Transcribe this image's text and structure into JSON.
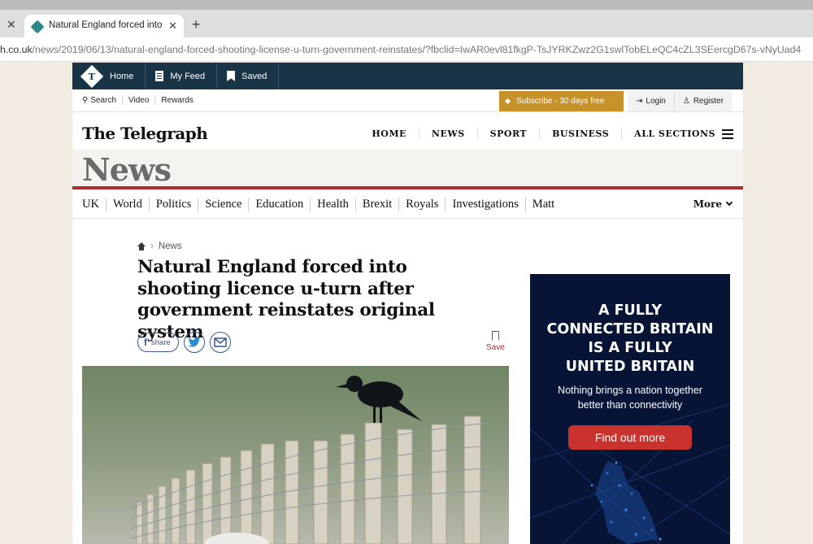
{
  "browser": {
    "tab_title": "Natural England forced into sho",
    "url_prefix": "h.co.uk",
    "url_path": "/news/2019/06/13/natural-england-forced-shooting-license-u-turn-government-reinstates/?fbclid=IwAR0evl81fkgP-TsJYRKZwz2G1swlTobELeQC4cZL3SEercgD67s-vNyUad4",
    "close_glyph": "✕",
    "new_tab_glyph": "+"
  },
  "topnav": {
    "home": "Home",
    "feed": "My Feed",
    "saved": "Saved",
    "logo_letter": "T"
  },
  "util": {
    "search": "Search",
    "video": "Video",
    "rewards": "Rewards",
    "subscribe": "Subscribe - 30 days free",
    "login": "Login",
    "register": "Register"
  },
  "masthead": {
    "brand": "The Telegraph",
    "nav": [
      "HOME",
      "NEWS",
      "SPORT",
      "BUSINESS",
      "ALL SECTIONS"
    ]
  },
  "section": {
    "title": "News"
  },
  "subnav": {
    "items": [
      "UK",
      "World",
      "Politics",
      "Science",
      "Education",
      "Health",
      "Brexit",
      "Royals",
      "Investigations",
      "Matt"
    ],
    "more": "More"
  },
  "article": {
    "breadcrumb": "News",
    "headline": "Natural England forced into shooting licence u-turn after government reinstates original system",
    "share_label": "share",
    "save_label": "Save"
  },
  "ad": {
    "headline_lines": [
      "A FULLY",
      "CONNECTED BRITAIN",
      "IS A FULLY",
      "UNITED BRITAIN"
    ],
    "sub_lines": [
      "Nothing brings a nation together",
      "better than connectivity"
    ],
    "cta": "Find out more"
  },
  "colors": {
    "topnav_bg": "#183446",
    "subscribe_bg": "#c8922a",
    "section_rule": "#b12b2b",
    "ad_bg": "#071436",
    "ad_cta": "#c9322d"
  }
}
